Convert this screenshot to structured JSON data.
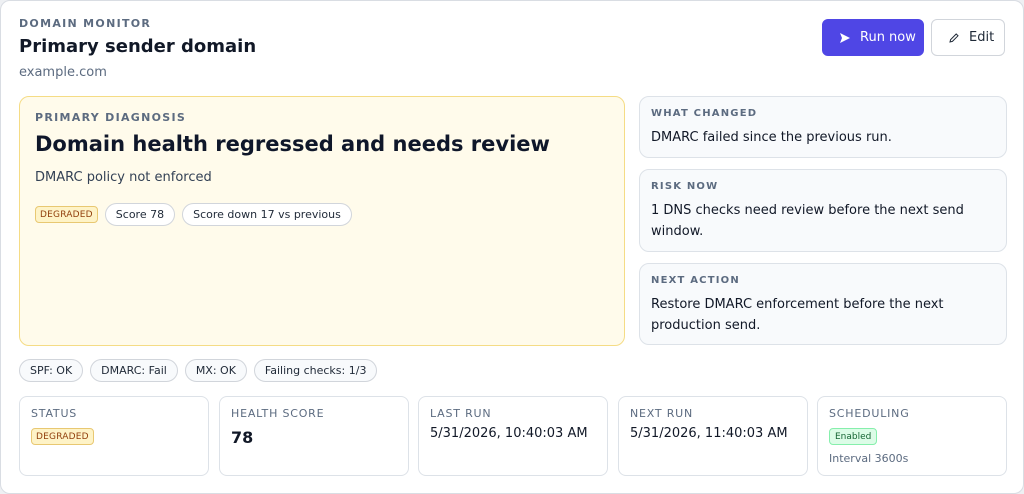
{
  "header": {
    "eyebrow": "DOMAIN MONITOR",
    "title": "Primary sender domain",
    "domain": "example.com",
    "run_label": "Run now",
    "edit_label": "Edit"
  },
  "diagnosis": {
    "eyebrow": "PRIMARY DIAGNOSIS",
    "title": "Domain health regressed and needs review",
    "subtitle": "DMARC policy not enforced",
    "status_badge": "DEGRADED",
    "score_pill": "Score 78",
    "trend_pill": "Score down 17 vs previous"
  },
  "side": [
    {
      "eyebrow": "WHAT CHANGED",
      "text": "DMARC failed since the previous run."
    },
    {
      "eyebrow": "RISK NOW",
      "text": "1 DNS checks need review before the next send window."
    },
    {
      "eyebrow": "NEXT ACTION",
      "text": "Restore DMARC enforcement before the next production send."
    }
  ],
  "checks": [
    "SPF: OK",
    "DMARC: Fail",
    "MX: OK",
    "Failing checks: 1/3"
  ],
  "stats": {
    "status": {
      "label": "STATUS",
      "badge": "DEGRADED"
    },
    "health": {
      "label": "HEALTH SCORE",
      "value": "78"
    },
    "last_run": {
      "label": "LAST RUN",
      "value": "5/31/2026, 10:40:03 AM"
    },
    "next_run": {
      "label": "NEXT RUN",
      "value": "5/31/2026, 11:40:03 AM"
    },
    "scheduling": {
      "label": "SCHEDULING",
      "badge": "Enabled",
      "interval": "Interval 3600s"
    }
  },
  "colors": {
    "accent": "#4f46e5",
    "warning_bg": "#fffbeb",
    "warning_border": "#f5dc85",
    "success_bg": "#dcfce7"
  },
  "icons": {
    "run": "send-icon",
    "edit": "pencil-icon"
  }
}
